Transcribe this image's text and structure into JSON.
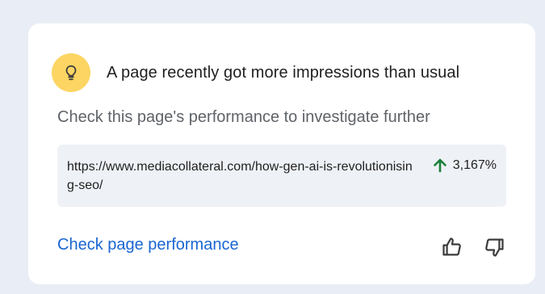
{
  "card": {
    "icon": "lightbulb-icon",
    "title": "A page recently got more impressions than usual",
    "subtitle": "Check this page's performance to investigate further",
    "url": "https://www.mediacollateral.com/how-gen-ai-is-revolutionising-seo/",
    "change": {
      "icon": "arrow-up-icon",
      "value": "3,167%",
      "color": "#188038"
    },
    "action_label": "Check page performance",
    "feedback": {
      "up_icon": "thumb-up-icon",
      "down_icon": "thumb-down-icon"
    }
  },
  "colors": {
    "background": "#e9eef6",
    "card": "#ffffff",
    "icon_badge": "#fcd563",
    "link": "#1a66d2",
    "url_box": "#eef1f6"
  }
}
